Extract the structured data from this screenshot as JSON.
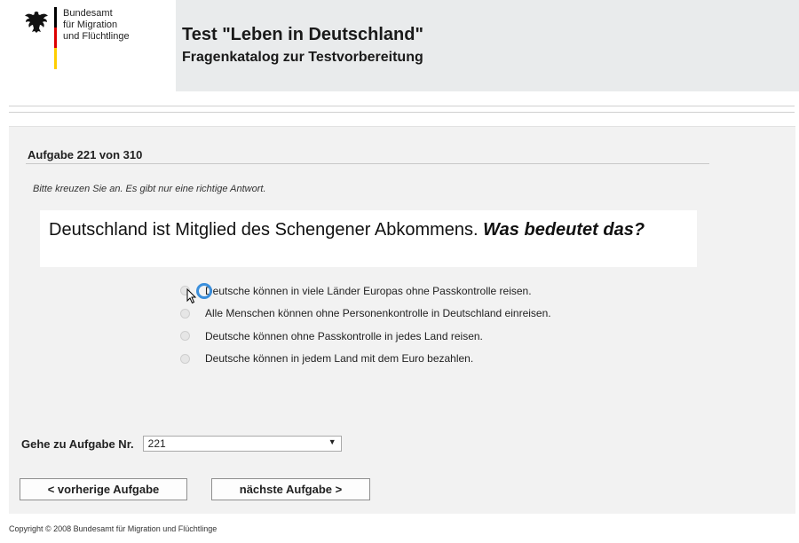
{
  "header": {
    "agency_line1": "Bundesamt",
    "agency_line2": "für Migration",
    "agency_line3": "und Flüchtlinge",
    "title": "Test \"Leben in Deutschland\"",
    "subtitle": "Fragenkatalog zur Testvorbereitung"
  },
  "task": {
    "counter": "Aufgabe 221 von 310",
    "instruction": "Bitte kreuzen Sie an. Es gibt nur eine richtige Antwort.",
    "question_plain": "Deutschland ist Mitglied des Schengener Abkommens.",
    "question_emphasis": "Was bedeutet das?",
    "answers": [
      {
        "label": "Deutsche können in viele Länder Europas ohne Passkontrolle reisen."
      },
      {
        "label": "Alle Menschen können ohne Personenkontrolle in Deutschland einreisen."
      },
      {
        "label": "Deutsche können ohne Passkontrolle in jedes Land reisen."
      },
      {
        "label": "Deutsche können in jedem Land mit dem Euro bezahlen."
      }
    ]
  },
  "navigation": {
    "goto_label": "Gehe zu Aufgabe Nr.",
    "goto_value": "221",
    "prev_label": "< vorherige Aufgabe",
    "next_label": "nächste Aufgabe >"
  },
  "footer": {
    "copyright": "Copyright © 2008 Bundesamt für Migration und Flüchtlinge"
  },
  "colors": {
    "flag_black": "#000000",
    "flag_red": "#dd0000",
    "flag_gold": "#ffce00",
    "focus_ring": "#3b8fdc",
    "panel_bg": "#f2f2f2",
    "header_bg": "#e9ebec"
  },
  "icons": {
    "logo": "federal-eagle-icon",
    "dropdown": "chevron-down-icon",
    "pointer": "mouse-cursor-icon"
  }
}
